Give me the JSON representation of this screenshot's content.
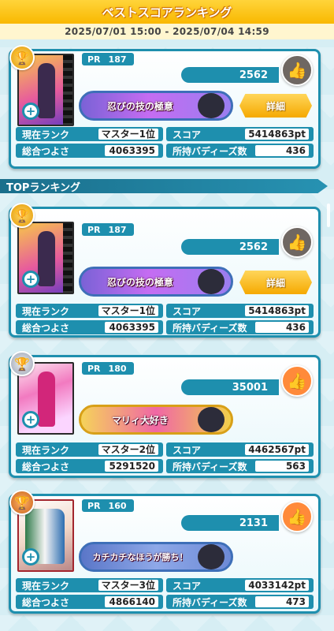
{
  "header": {
    "title": "ベストスコアランキング",
    "period": "2025/07/01 15:00 - 2025/07/04 14:59"
  },
  "section": {
    "top_ranking": "TOPランキング"
  },
  "labels": {
    "pr": "PR",
    "rank": "現在ランク",
    "score": "スコア",
    "power": "総合つよさ",
    "buddies": "所持バディーズ数",
    "detail": "詳細"
  },
  "best": {
    "pr": "187",
    "likes": "2562",
    "skill": "忍びの技の極意",
    "rank": "マスター1位",
    "score": "5414863pt",
    "power": "4063395",
    "buddies": "436"
  },
  "ranking": [
    {
      "pr": "187",
      "likes": "2562",
      "skill": "忍びの技の極意",
      "rank": "マスター1位",
      "score": "5414863pt",
      "power": "4063395",
      "buddies": "436"
    },
    {
      "pr": "180",
      "likes": "35001",
      "skill": "マリィ大好き",
      "rank": "マスター2位",
      "score": "4462567pt",
      "power": "5291520",
      "buddies": "563"
    },
    {
      "pr": "160",
      "likes": "2131",
      "skill": "カチカチなほうが勝ち！",
      "rank": "マスター3位",
      "score": "4033142pt",
      "power": "4866140",
      "buddies": "473"
    }
  ]
}
